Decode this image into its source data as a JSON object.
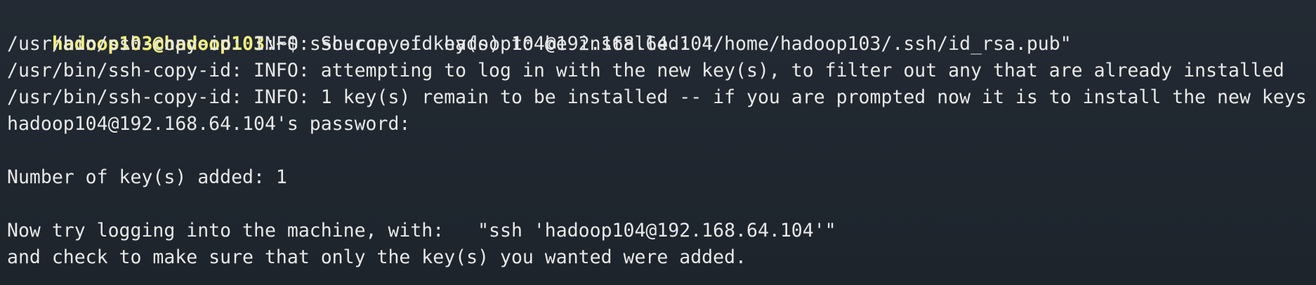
{
  "terminal": {
    "prompt": {
      "user_host": "hadoop103@hadoop103",
      "separator": ":",
      "cwd_and_symbol": "~$ ",
      "command": "ssh-copy-id hadoop104@192.168.64.104"
    },
    "output_lines": [
      "/usr/bin/ssh-copy-id: INFO: Source of key(s) to be installed: \"/home/hadoop103/.ssh/id_rsa.pub\"",
      "/usr/bin/ssh-copy-id: INFO: attempting to log in with the new key(s), to filter out any that are already installed",
      "/usr/bin/ssh-copy-id: INFO: 1 key(s) remain to be installed -- if you are prompted now it is to install the new keys",
      "hadoop104@192.168.64.104's password:",
      "",
      "Number of key(s) added: 1",
      "",
      "Now try logging into the machine, with:   \"ssh 'hadoop104@192.168.64.104'\"",
      "and check to make sure that only the key(s) you wanted were added."
    ],
    "colors": {
      "background": "#1f2730",
      "prompt_user": "#f2ef7a",
      "text": "#e8e8e8"
    }
  }
}
